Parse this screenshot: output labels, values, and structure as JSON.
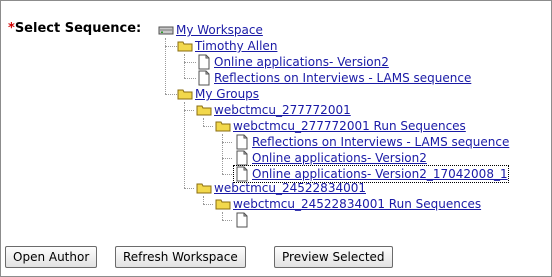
{
  "form": {
    "required_marker": "*",
    "label": "Select Sequence:"
  },
  "tree": {
    "root": "My Workspace",
    "user_folder": "Timothy Allen",
    "user_items": [
      "Online applications- Version2",
      "Reflections on Interviews - LAMS sequence"
    ],
    "groups_folder": "My Groups",
    "group1": {
      "folder": "webctmcu_277772001",
      "subfolder": "webctmcu_277772001 Run Sequences",
      "items": [
        "Reflections on Interviews - LAMS sequence",
        "Online applications- Version2",
        "Online applications- Version2_17042008_1"
      ]
    },
    "group2": {
      "folder": "webctmcu_24522834001",
      "subfolder": "webctmcu_24522834001 Run Sequences"
    }
  },
  "buttons": {
    "open_author": "Open Author",
    "refresh_workspace": "Refresh Workspace",
    "preview_selected": "Preview Selected"
  },
  "colors": {
    "link": "#1a1aa6",
    "required": "#d00000",
    "folder": "#f2d84c"
  },
  "icons": {
    "workspace": "drive-icon",
    "folder": "folder-icon",
    "document": "document-icon"
  }
}
